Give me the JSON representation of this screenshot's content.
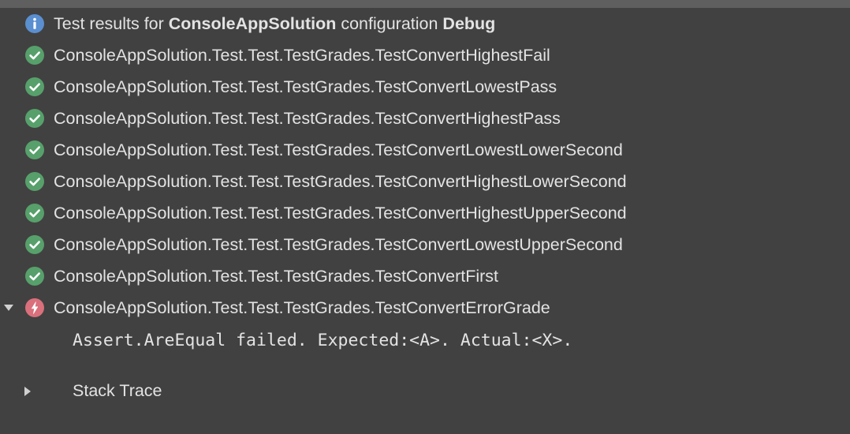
{
  "header": {
    "prefix": "Test results for ",
    "solution": "ConsoleAppSolution",
    "middle": " configuration ",
    "configuration": "Debug",
    "icon": "info-icon"
  },
  "tests": [
    {
      "name": "ConsoleAppSolution.Test.Test.TestGrades.TestConvertHighestFail",
      "status": "passed",
      "icon": "check-circle-icon"
    },
    {
      "name": "ConsoleAppSolution.Test.Test.TestGrades.TestConvertLowestPass",
      "status": "passed",
      "icon": "check-circle-icon"
    },
    {
      "name": "ConsoleAppSolution.Test.Test.TestGrades.TestConvertHighestPass",
      "status": "passed",
      "icon": "check-circle-icon"
    },
    {
      "name": "ConsoleAppSolution.Test.Test.TestGrades.TestConvertLowestLowerSecond",
      "status": "passed",
      "icon": "check-circle-icon"
    },
    {
      "name": "ConsoleAppSolution.Test.Test.TestGrades.TestConvertHighestLowerSecond",
      "status": "passed",
      "icon": "check-circle-icon"
    },
    {
      "name": "ConsoleAppSolution.Test.Test.TestGrades.TestConvertHighestUpperSecond",
      "status": "passed",
      "icon": "check-circle-icon"
    },
    {
      "name": "ConsoleAppSolution.Test.Test.TestGrades.TestConvertLowestUpperSecond",
      "status": "passed",
      "icon": "check-circle-icon"
    },
    {
      "name": "ConsoleAppSolution.Test.Test.TestGrades.TestConvertFirst",
      "status": "passed",
      "icon": "check-circle-icon"
    },
    {
      "name": "ConsoleAppSolution.Test.Test.TestGrades.TestConvertErrorGrade",
      "status": "error",
      "icon": "lightning-circle-icon",
      "expanded": true
    }
  ],
  "failure": {
    "message": "Assert.AreEqual failed. Expected:<A>. Actual:<X>.",
    "stack_trace_label": "Stack Trace",
    "stack_trace_expanded": false
  },
  "colors": {
    "background": "#414141",
    "passed": "#57a06b",
    "error": "#d9707c",
    "info": "#5a8fd0",
    "text": "#e3e3e3"
  }
}
